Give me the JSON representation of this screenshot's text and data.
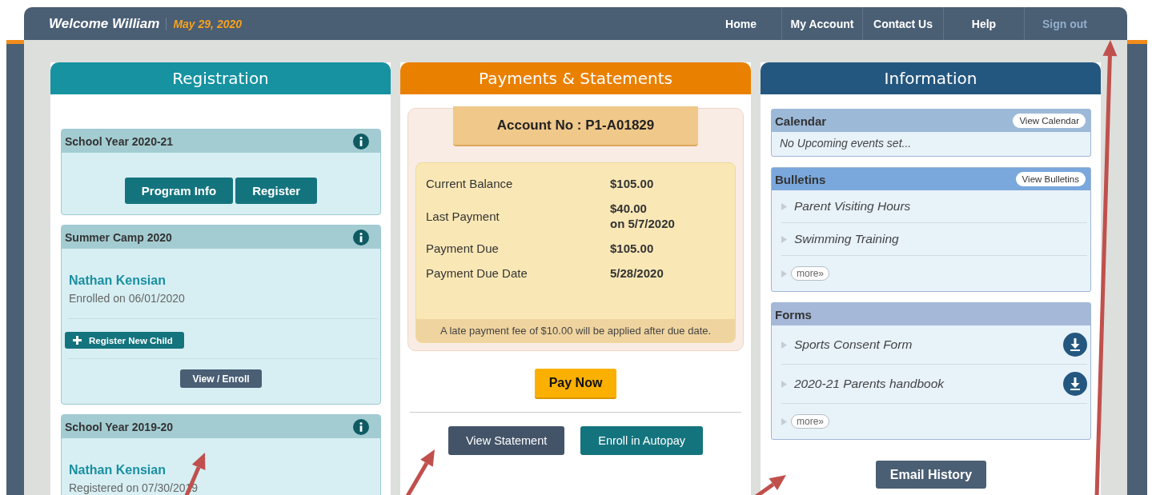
{
  "header": {
    "welcome": "Welcome William",
    "date": "May 29, 2020",
    "nav": [
      {
        "label": "Home",
        "kind": "link"
      },
      {
        "label": "My Account",
        "kind": "link"
      },
      {
        "label": "Contact Us",
        "kind": "link"
      },
      {
        "label": "Help",
        "kind": "link"
      },
      {
        "label": "Sign out",
        "kind": "signout"
      }
    ]
  },
  "registration": {
    "title": "Registration",
    "programs": [
      {
        "title": "School Year 2020-21",
        "actions": [
          "Program Info",
          "Register"
        ]
      },
      {
        "title": "Summer Camp 2020",
        "children": [
          {
            "name": "Nathan Kensian",
            "status": "Enrolled on 06/01/2020"
          }
        ],
        "add_child": "Register New Child",
        "view": "View / Enroll"
      },
      {
        "title": "School Year 2019-20",
        "children": [
          {
            "name": "Nathan Kensian",
            "status": "Registered on 07/30/2019"
          }
        ]
      }
    ]
  },
  "payments": {
    "title": "Payments & Statements",
    "account": "Account No : P1-A01829",
    "rows": [
      {
        "label": "Current Balance",
        "value": "$105.00"
      },
      {
        "label": "Last Payment",
        "value": "$40.00",
        "note": "on 5/7/2020"
      },
      {
        "label": "Payment Due",
        "value": "$105.00"
      },
      {
        "label": "Payment Due Date",
        "value": "5/28/2020"
      }
    ],
    "late_note": "A late payment fee of $10.00 will be applied after due date.",
    "pay_button": "Pay Now",
    "buttons": [
      {
        "label": "View Statement",
        "kind": "secondary"
      },
      {
        "label": "Enroll in Autopay",
        "kind": "primary"
      }
    ]
  },
  "information": {
    "title": "Information",
    "sections": [
      {
        "title": "Calendar",
        "color": "#9db9d8",
        "action": "View Calendar",
        "empty": "No Upcoming events set..."
      },
      {
        "title": "Bulletins",
        "color": "#7aa7dc",
        "action": "View Bulletins",
        "items": [
          {
            "label": "Parent Visiting Hours",
            "download": false
          },
          {
            "label": "Swimming Training",
            "download": false
          }
        ],
        "more": "more»"
      },
      {
        "title": "Forms",
        "color": "#a6b8d8",
        "items": [
          {
            "label": "Sports Consent Form",
            "download": true
          },
          {
            "label": "2020-21 Parents handbook",
            "download": true
          }
        ],
        "more": "more»"
      }
    ],
    "email_button": "Email History"
  }
}
